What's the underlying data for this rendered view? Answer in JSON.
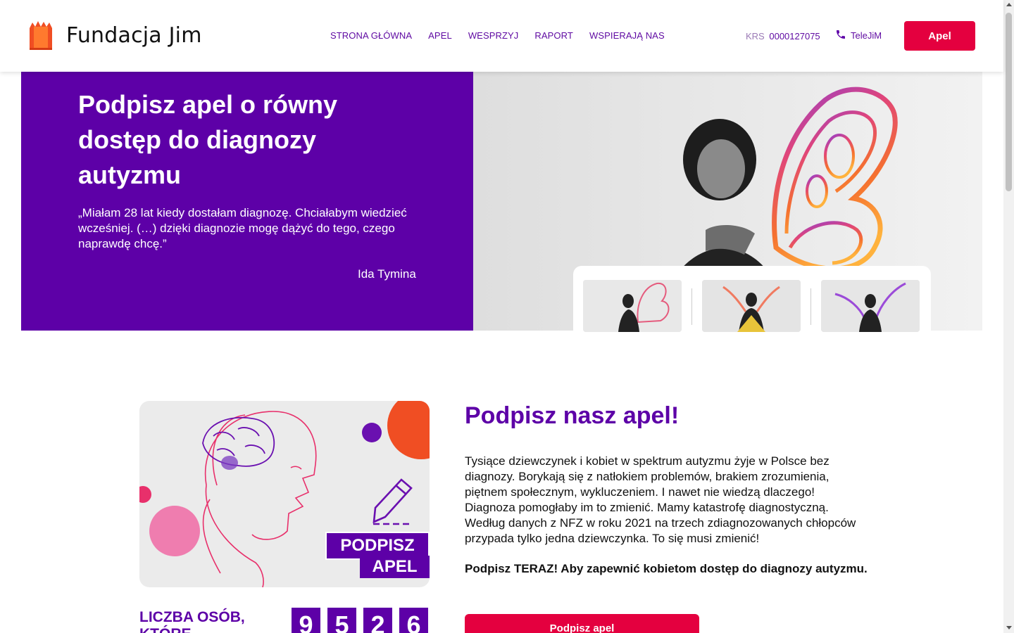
{
  "header": {
    "logo_text": "Fundacja Jim",
    "nav": [
      "STRONA GŁÓWNA",
      "APEL",
      "WESPRZYJ",
      "RAPORT",
      "WSPIERAJĄ NAS"
    ],
    "krs_label": "KRS",
    "krs_number": "0000127075",
    "tele_label": "TeleJiM",
    "apel_button": "Apel"
  },
  "hero": {
    "title": "Podpisz apel o równy dostęp do diagnozy autyzmu",
    "quote": "„Miałam 28 lat kiedy dostałam diagnozę. Chciałabym wiedzieć wcześniej. (…) dzięki diagnozie mogę dążyć do tego, czego naprawdę chcę.”",
    "author": "Ida Tymina"
  },
  "petition": {
    "badge_line1": "PODPISZ",
    "badge_line2": "APEL",
    "title": "Podpisz nasz apel!",
    "body": "Tysiące dziewczynek i kobiet w spektrum autyzmu żyje w Polsce bez diagnozy. Borykają się z natłokiem problemów, brakiem zrozumienia, piętnem społecznym, wykluczeniem. I nawet nie wiedzą dlaczego! Diagnoza pomogłaby im to zmienić. Mamy katastrofę diagnostyczną. Według danych z NFZ w roku 2021 na trzech zdiagnozowanych chłopców przypada tylko jedna dziewczynka. To się musi zmienić!",
    "cta_text": "Podpisz TERAZ! Aby zapewnić kobietom dostęp do diagnozy autyzmu.",
    "sign_button": "Podpisz apel",
    "counter_label": "Liczba osób, które podpisały apel:",
    "digits": [
      "9",
      "5",
      "2",
      "6"
    ]
  },
  "colors": {
    "brand_purple": "#5d00a7",
    "accent_red": "#e4003f",
    "logo_orange": "#f04e23"
  },
  "icons": [
    "fundacja-jim-logo-icon",
    "phone-icon",
    "pencil-icon",
    "butterfly-wings-icon"
  ]
}
